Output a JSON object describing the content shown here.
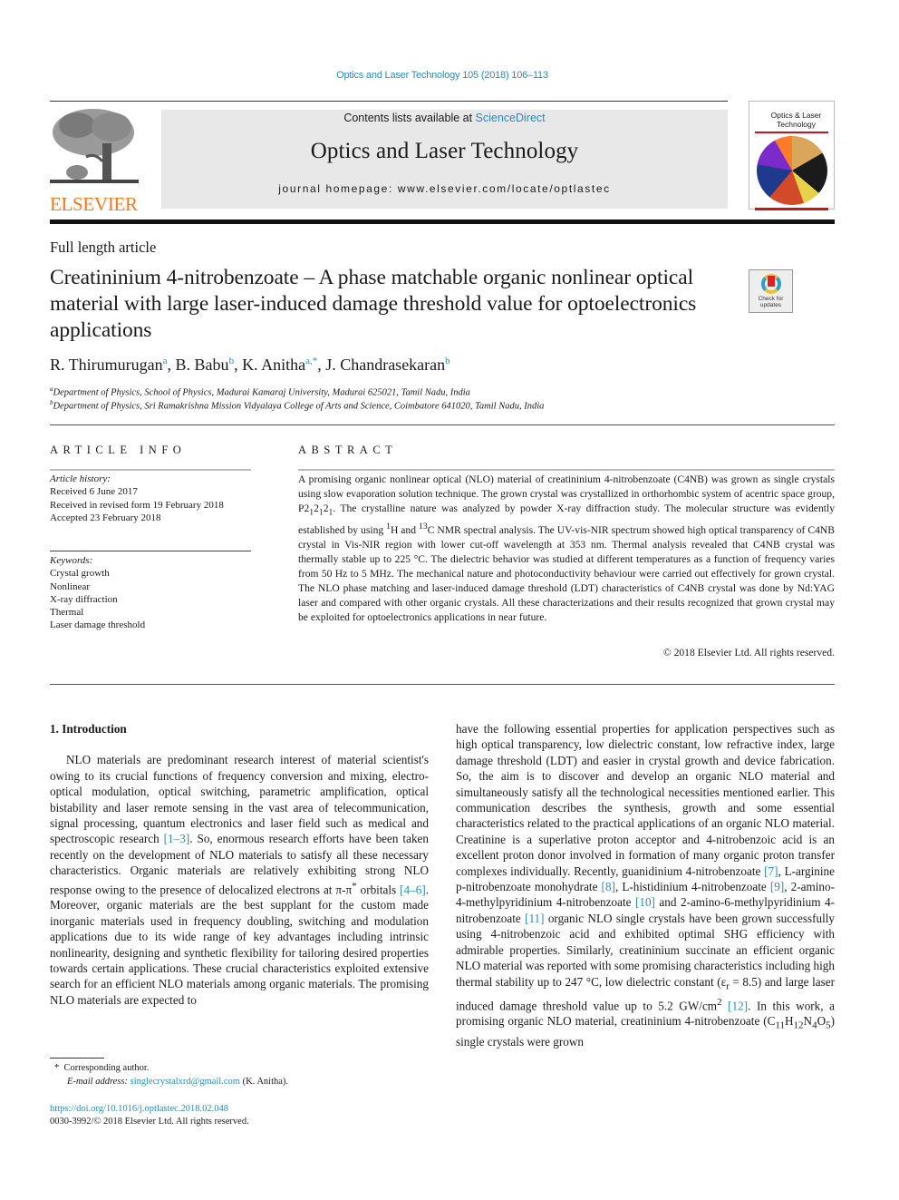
{
  "header": {
    "journal_reference": "Optics and Laser Technology 105 (2018) 106–113",
    "publisher_logo_text": "ELSEVIER",
    "contents_prefix": "Contents lists available at ",
    "contents_link": "ScienceDirect",
    "journal_title": "Optics and Laser Technology",
    "homepage": "journal homepage: www.elsevier.com/locate/optlastec",
    "cover_title": "Optics & Laser Technology",
    "check_updates_label": "Check for updates"
  },
  "article": {
    "type": "Full length article",
    "title": "Creatininium 4-nitrobenzoate – A phase matchable organic nonlinear optical material with large laser-induced damage threshold value for optoelectronics applications",
    "authors": [
      {
        "name": "R. Thirumurugan",
        "aff": "a"
      },
      {
        "name": "B. Babu",
        "aff": "b"
      },
      {
        "name": "K. Anitha",
        "aff": "a,*"
      },
      {
        "name": "J. Chandrasekaran",
        "aff": "b"
      }
    ],
    "affiliations": [
      {
        "key": "a",
        "text": "Department of Physics, School of Physics, Madurai Kamaraj University, Madurai 625021, Tamil Nadu, India"
      },
      {
        "key": "b",
        "text": "Department of Physics, Sri Ramakrishna Mission Vidyalaya College of Arts and Science, Coimbatore 641020, Tamil Nadu, India"
      }
    ]
  },
  "article_info": {
    "heading": "ARTICLE INFO",
    "history_label": "Article history:",
    "history": [
      "Received 6 June 2017",
      "Received in revised form 19 February 2018",
      "Accepted 23 February 2018"
    ],
    "keywords_label": "Keywords:",
    "keywords": [
      "Crystal growth",
      "Nonlinear",
      "X-ray diffraction",
      "Thermal",
      "Laser damage threshold"
    ]
  },
  "abstract": {
    "heading": "ABSTRACT",
    "p1": "A promising organic nonlinear optical (NLO) material of creatininium 4-nitrobenzoate (C4NB) was grown as single crystals using slow evaporation solution technique. The grown crystal was crystallized in orthorhombic system of acentric space group, P2",
    "p2": ". The crystalline nature was analyzed by powder X-ray diffraction study. The molecular structure was evidently established by using ",
    "p3": "H and ",
    "p4": "C NMR spectral analysis. The UV-vis-NIR spectrum showed high optical transparency of C4NB crystal in Vis-NIR region with lower cut-off wavelength at 353 nm. Thermal analysis revealed that C4NB crystal was thermally stable up to 225 °C. The dielectric behavior was studied at different temperatures as a function of frequency varies from 50 Hz to 5 MHz. The mechanical nature and photoconductivity behaviour were carried out effectively for grown crystal. The NLO phase matching and laser-induced damage threshold (LDT) characteristics of C4NB crystal was done by Nd:YAG laser and compared with other organic crystals. All these characterizations and their results recognized that grown crystal may be exploited for optoelectronics applications in near future.",
    "sub_1": "1",
    "sup_1": "1",
    "sup_13": "13",
    "copyright": "© 2018 Elsevier Ltd. All rights reserved."
  },
  "body": {
    "section_heading": "1. Introduction",
    "left": {
      "t1": "NLO materials are predominant research interest of material scientist's owing to its crucial functions of frequency conversion and mixing, electro-optical modulation, optical switching, parametric amplification, optical bistability and laser remote sensing in the vast area of telecommunication, signal processing, quantum electronics and laser field such as medical and spectroscopic research ",
      "r1": "[1–3]",
      "t2": ". So, enormous research efforts have been taken recently on the development of NLO materials to satisfy all these necessary characteristics. Organic materials are relatively exhibiting strong NLO response owing to the presence of delocalized electrons at π-π",
      "t2b": " orbitals ",
      "r2": "[4–6]",
      "t3": ". Moreover, organic materials are the best supplant for the custom made inorganic materials used in frequency doubling, switching and modulation applications due to its wide range of key advantages including intrinsic nonlinearity, designing and synthetic flexibility for tailoring desired properties towards certain applications. These crucial characteristics exploited extensive search for an efficient NLO materials among organic materials. The promising NLO materials are expected to"
    },
    "right": {
      "t1": "have the following essential properties for application perspectives such as high optical transparency, low dielectric constant, low refractive index, large damage threshold (LDT) and easier in crystal growth and device fabrication. So, the aim is to discover and develop an organic NLO material and simultaneously satisfy all the technological necessities mentioned earlier. This communication describes the synthesis, growth and some essential characteristics related to the practical applications of an organic NLO material. Creatinine is a superlative proton acceptor and 4-nitrobenzoic acid is an excellent proton donor involved in formation of many organic proton transfer complexes individually. Recently, guanidinium 4-nitrobenzoate ",
      "r7": "[7]",
      "t2": ", L-arginine p-nitrobenzoate monohydrate ",
      "r8": "[8]",
      "t3": ", L-histidinium 4-nitrobenzoate ",
      "r9": "[9]",
      "t4": ", 2-amino-4-methylpyridinium 4-nitrobenzoate ",
      "r10": "[10]",
      "t5": " and 2-amino-6-methylpyridinium 4-nitrobenzoate ",
      "r11": "[11]",
      "t6": " organic NLO single crystals have been grown successfully using 4-nitrobenzoic acid and exhibited optimal SHG efficiency with admirable properties. Similarly, creatininium succinate an efficient organic NLO material was reported with some promising characteristics including high thermal stability up to 247 °C, low dielectric constant (ε",
      "t6sub": "r",
      "t7": " = 8.5) and large laser induced damage threshold value up to 5.2 GW/cm",
      "t7sup": "2",
      "t8": " ",
      "r12": "[12]",
      "t9": ". In this work, a promising organic NLO material, creatininium 4-nitrobenzoate (C",
      "f1": "11",
      "f2": "H",
      "f3": "12",
      "f4": "N",
      "f5": "4",
      "f6": "O",
      "f7": "5",
      "t10": ") single crystals were grown"
    }
  },
  "footnotes": {
    "marker": "*",
    "corresponding": "Corresponding author.",
    "email_label": "E-mail address: ",
    "email": "singlecrystalxrd@gmail.com",
    "email_suffix": " (K. Anitha).",
    "doi": "https://doi.org/10.1016/j.optlastec.2018.02.048",
    "issn": "0030-3992/© 2018 Elsevier Ltd. All rights reserved."
  },
  "colors": {
    "link": "#2a8bb8",
    "elsevier_orange": "#f07a1c",
    "banner_bg": "#e8e8e8"
  }
}
